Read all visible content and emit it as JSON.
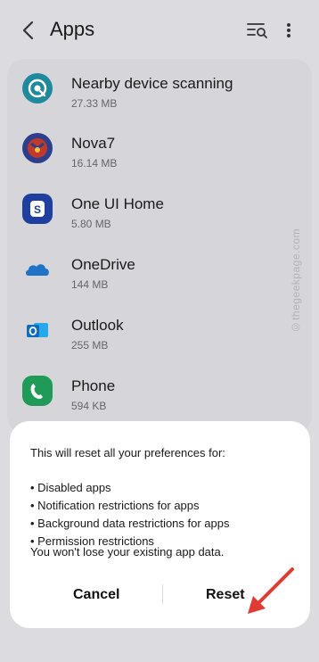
{
  "header": {
    "title": "Apps"
  },
  "apps": [
    {
      "name": "Nearby device scanning",
      "size": "27.33 MB",
      "icon": "nearby-scan-icon",
      "color": "#1f8a9e"
    },
    {
      "name": "Nova7",
      "size": "16.14 MB",
      "icon": "nova7-icon",
      "color": "#c0392b"
    },
    {
      "name": "One UI Home",
      "size": "5.80 MB",
      "icon": "one-ui-home-icon",
      "color": "#1f3fa0"
    },
    {
      "name": "OneDrive",
      "size": "144 MB",
      "icon": "onedrive-icon",
      "color": "#1e73c8"
    },
    {
      "name": "Outlook",
      "size": "255 MB",
      "icon": "outlook-icon",
      "color": "#0f6cbd"
    },
    {
      "name": "Phone",
      "size": "594 KB",
      "icon": "phone-icon",
      "color": "#1f9a57"
    }
  ],
  "dialog": {
    "intro": "This will reset all your preferences for:",
    "bullets": [
      "• Disabled apps",
      "• Notification restrictions for apps",
      "• Background data restrictions for apps",
      "• Permission restrictions"
    ],
    "note": "You won't lose your existing app data.",
    "cancel_label": "Cancel",
    "reset_label": "Reset"
  },
  "watermark": "©thegeekpage.com",
  "colors": {
    "annotation_arrow": "#e23b33",
    "dialog_bg": "#ffffff",
    "screen_bg": "#dcdbe0"
  }
}
